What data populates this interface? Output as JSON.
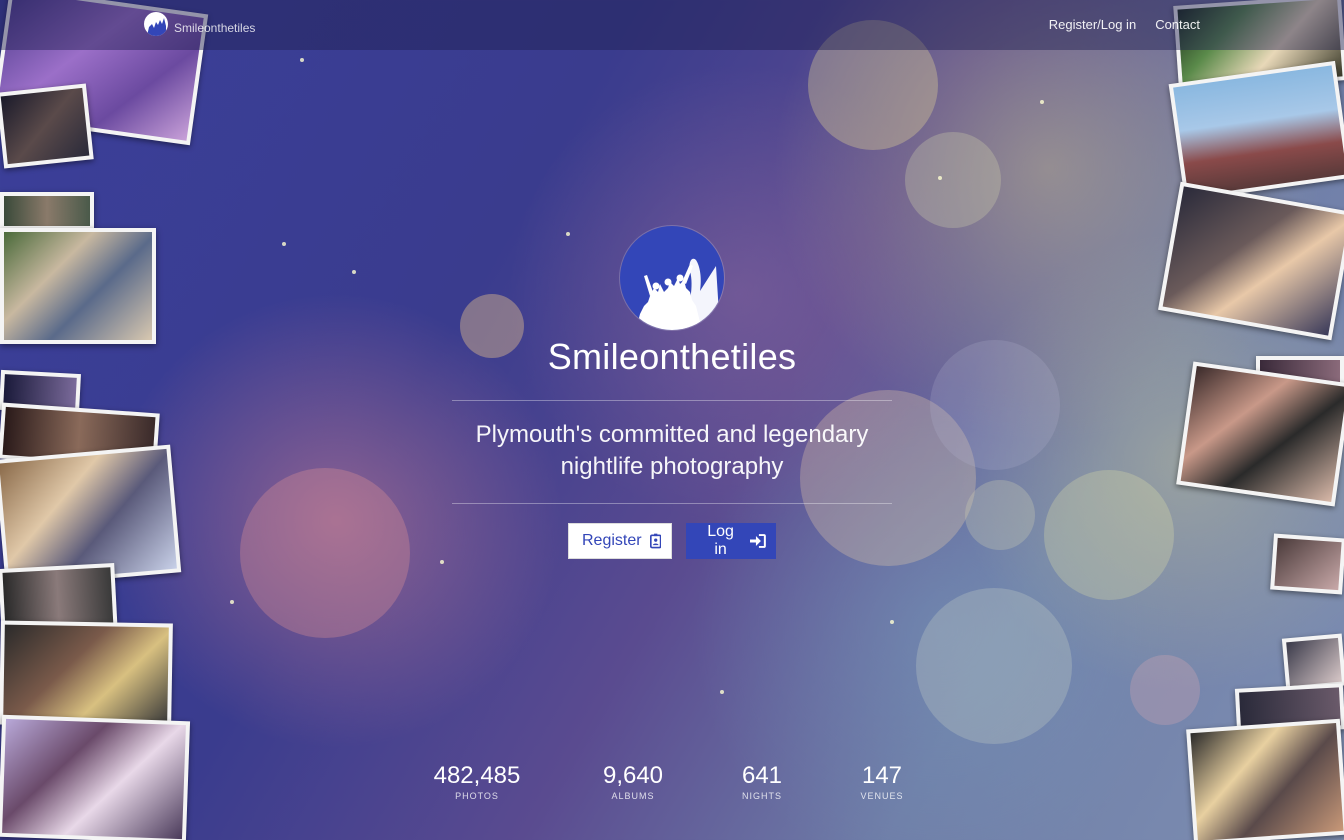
{
  "header": {
    "brand_name": "Smileonthetiles",
    "nav": [
      {
        "label": "Register/Log in"
      },
      {
        "label": "Contact"
      }
    ]
  },
  "hero": {
    "title": "Smileonthetiles",
    "tagline_line1": "Plymouth's committed and legendary",
    "tagline_line2": "nightlife photography",
    "register_label": "Register",
    "login_label": "Log in"
  },
  "stats": [
    {
      "value": "482,485",
      "label": "PHOTOS"
    },
    {
      "value": "9,640",
      "label": "ALBUMS"
    },
    {
      "value": "641",
      "label": "NIGHTS"
    },
    {
      "value": "147",
      "label": "VENUES"
    }
  ],
  "colors": {
    "brand_blue": "#3346b8",
    "white": "#ffffff"
  },
  "icons": {
    "register": "id-badge-icon",
    "login": "sign-in-icon",
    "logo": "crowd-silhouette-logo"
  }
}
